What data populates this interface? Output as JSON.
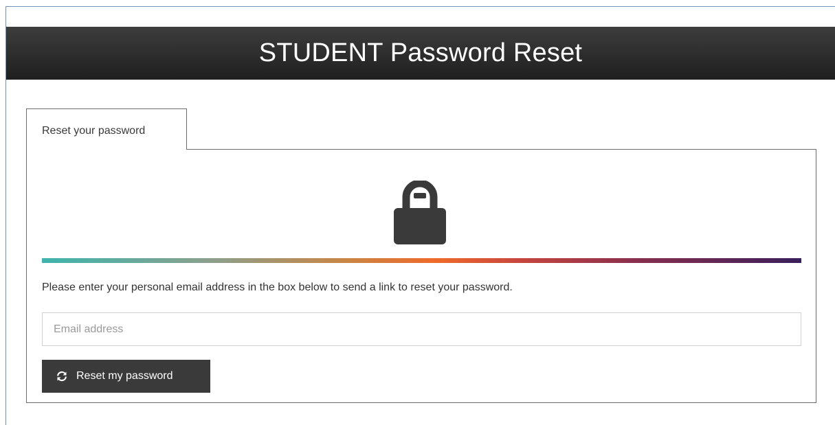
{
  "header": {
    "title": "STUDENT Password Reset"
  },
  "tab": {
    "label": "Reset your password"
  },
  "main": {
    "icon": "lock-icon",
    "instruction": "Please enter your personal email address in the box below to send a link to reset your password.",
    "email_input": {
      "placeholder": "Email address",
      "value": ""
    },
    "reset_button": {
      "icon": "refresh-icon",
      "label": "Reset my password"
    }
  },
  "colors": {
    "header_bg": "#2b2b2b",
    "button_bg": "#3a3a3a",
    "icon": "#3a3a3a",
    "gradient_stops": [
      "#3eb4ac",
      "#c98545",
      "#ef6a2a",
      "#c7463e",
      "#3a1f5c"
    ]
  }
}
